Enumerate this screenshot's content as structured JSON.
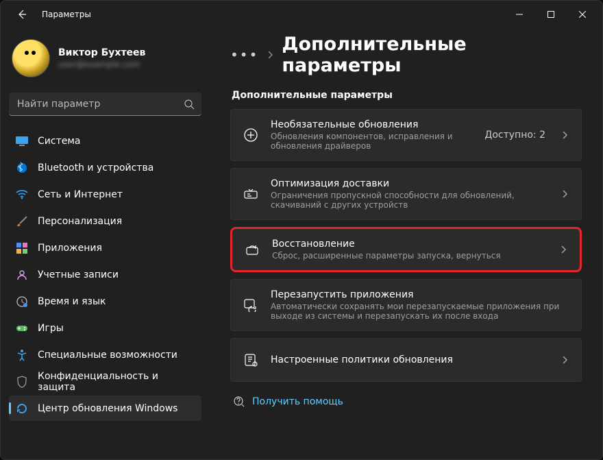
{
  "window": {
    "title": "Параметры"
  },
  "profile": {
    "name": "Виктор Бухтеев",
    "email": "user@example.com"
  },
  "search": {
    "placeholder": "Найти параметр"
  },
  "sidebar": {
    "items": [
      {
        "label": "Система"
      },
      {
        "label": "Bluetooth и устройства"
      },
      {
        "label": "Сеть и Интернет"
      },
      {
        "label": "Персонализация"
      },
      {
        "label": "Приложения"
      },
      {
        "label": "Учетные записи"
      },
      {
        "label": "Время и язык"
      },
      {
        "label": "Игры"
      },
      {
        "label": "Специальные возможности"
      },
      {
        "label": "Конфиденциальность и защита"
      },
      {
        "label": "Центр обновления Windows"
      }
    ]
  },
  "breadcrumb": {
    "dots": "•••",
    "title": "Дополнительные параметры"
  },
  "section": {
    "heading": "Дополнительные параметры"
  },
  "cards": [
    {
      "title": "Необязательные обновления",
      "sub": "Обновления компонентов, исправления и обновления драйверов",
      "right": "Доступно: 2"
    },
    {
      "title": "Оптимизация доставки",
      "sub": "Ограничения пропускной способности для обновлений, скачиваний с других устройств"
    },
    {
      "title": "Восстановление",
      "sub": "Сброс, расширенные параметры запуска, вернуться"
    },
    {
      "title": "Перезапустить приложения",
      "sub": "Автоматически сохранять мои перезапускаемые приложения при выходе из системы и перезапускать их после входа"
    },
    {
      "title": "Настроенные политики обновления",
      "sub": ""
    }
  ],
  "help": {
    "label": "Получить помощь"
  }
}
